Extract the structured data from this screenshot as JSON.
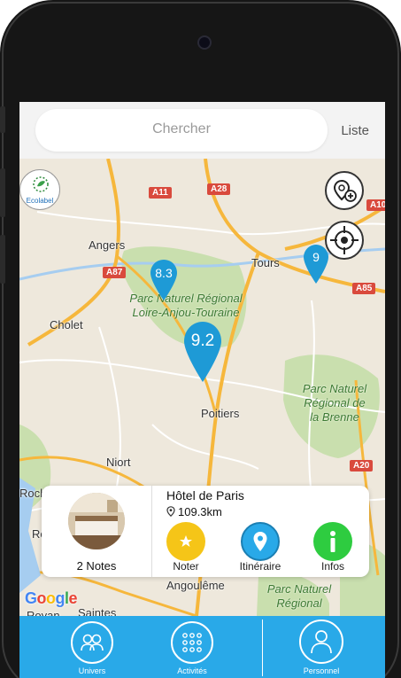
{
  "search": {
    "placeholder": "Chercher"
  },
  "header": {
    "list_label": "Liste"
  },
  "map": {
    "cities": [
      "Angers",
      "Tours",
      "Cholet",
      "Poitiers",
      "Niort",
      "Rochelle",
      "Roch",
      "Royan",
      "Saintes",
      "Angoulême"
    ],
    "roads": [
      "A11",
      "A28",
      "A10",
      "A87",
      "A85",
      "A20"
    ],
    "parks": [
      "Parc Naturel Régional\nLoire-Anjou-Touraine",
      "Parc Naturel\nRégional de\nla Brenne",
      "Parc Naturel\nRégional"
    ],
    "markers": [
      {
        "value": "8.3"
      },
      {
        "value": "9.2"
      },
      {
        "value": "9"
      }
    ],
    "ecolabel_text": "Ecolabel",
    "attribution": "Google"
  },
  "card": {
    "notes": "2 Notes",
    "hotel_name": "Hôtel de Paris",
    "distance": "109.3km",
    "actions": [
      "Noter",
      "Itinéraire",
      "Infos"
    ]
  },
  "bottom_nav": {
    "items": [
      "Univers",
      "Activités",
      "Personnel"
    ]
  },
  "colors": {
    "accent": "#29a9e8",
    "marker": "#1e9ad6",
    "noter": "#f5c518",
    "itineraire": "#29a9e8",
    "infos": "#2ecc40"
  }
}
